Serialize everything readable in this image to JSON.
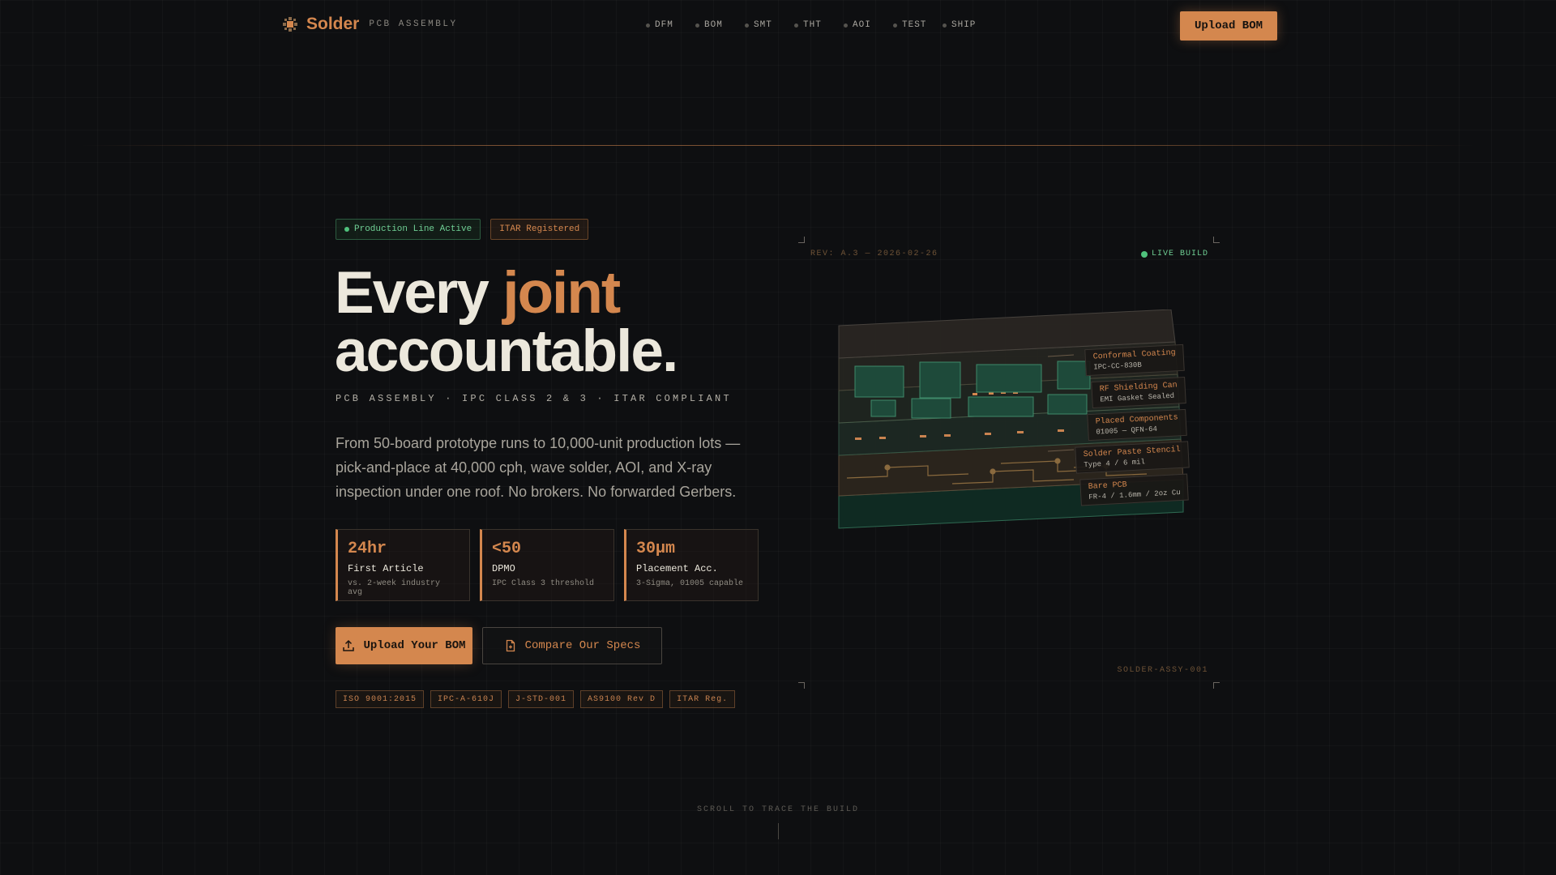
{
  "nav": {
    "brand": "Solder",
    "brand_sub": "PCB ASSEMBLY",
    "links": [
      "DFM",
      "BOM",
      "SMT",
      "THT",
      "AOI",
      "TEST",
      "SHIP"
    ],
    "cta": "Upload BOM"
  },
  "hero": {
    "badges": {
      "active": "Production Line Active",
      "itar": "ITAR Registered"
    },
    "headline": {
      "line1_a": "Every ",
      "line1_accent": "joint",
      "line2": "accountable."
    },
    "tagline": "PCB ASSEMBLY · IPC CLASS 2 & 3 · ITAR COMPLIANT",
    "description": "From 50-board prototype runs to 10,000-unit production lots — pick-and-place at 40,000 cph, wave solder, AOI, and X-ray inspection under one roof. No brokers. No forwarded Gerbers.",
    "stats": [
      {
        "value": "24hr",
        "label": "First Article",
        "note": "vs. 2-week industry avg"
      },
      {
        "value": "<50",
        "label": "DPMO",
        "note": "IPC Class 3 threshold"
      },
      {
        "value": "30µm",
        "label": "Placement Acc.",
        "note": "3-Sigma, 01005 capable"
      }
    ],
    "cta_primary": "Upload Your BOM",
    "cta_secondary": "Compare Our Specs",
    "certs": [
      "ISO 9001:2015",
      "IPC-A-610J",
      "J-STD-001",
      "AS9100 Rev D",
      "ITAR Reg."
    ]
  },
  "viz": {
    "rev": "REV: A.3 — 2026-02-26",
    "live": "LIVE BUILD",
    "assy": "SOLDER-ASSY-001",
    "layers": [
      {
        "name": "Conformal Coating",
        "sub": "IPC-CC-830B"
      },
      {
        "name": "RF Shielding Can",
        "sub": "EMI Gasket Sealed"
      },
      {
        "name": "Placed Components",
        "sub": "01005 — QFN-64"
      },
      {
        "name": "Solder Paste Stencil",
        "sub": "Type 4 / 6 mil"
      },
      {
        "name": "Bare PCB",
        "sub": "FR-4 / 1.6mm / 2oz Cu"
      }
    ]
  },
  "scroll_hint": "SCROLL TO TRACE THE BUILD",
  "colors": {
    "accent": "#d4874e",
    "green": "#4fc27c",
    "background": "#0e0f11"
  }
}
